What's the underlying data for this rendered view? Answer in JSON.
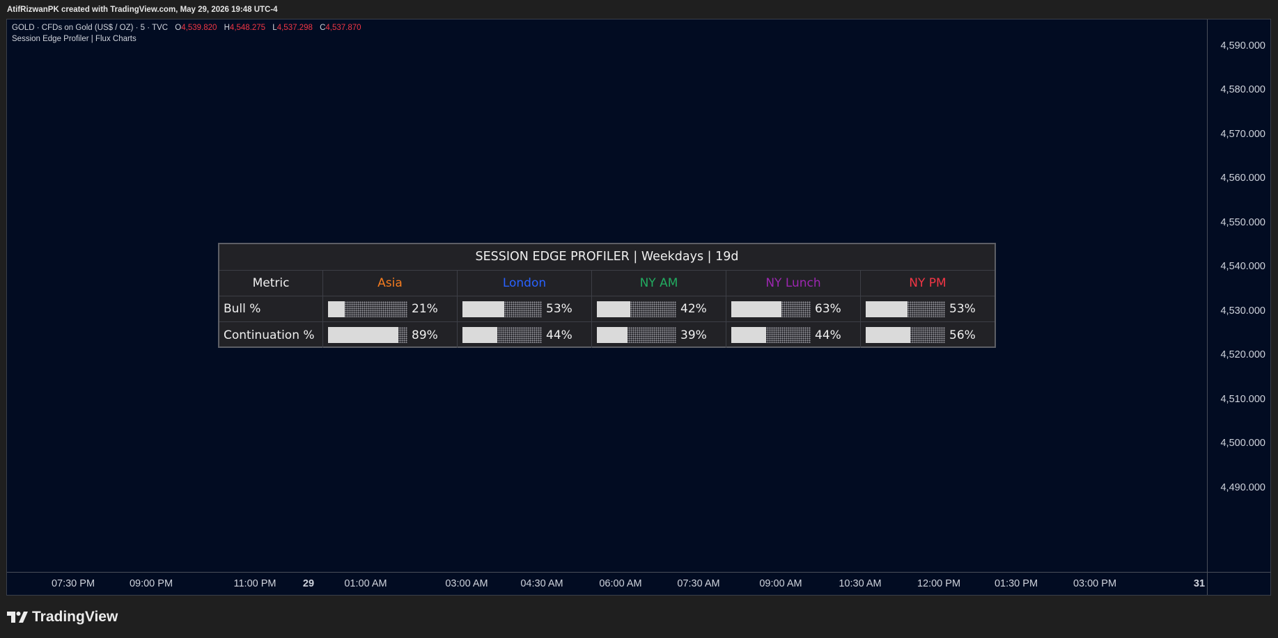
{
  "header": {
    "text": "AtifRizwanPK created with TradingView.com, May 29, 2026 19:48 UTC-4"
  },
  "legend": {
    "symbol": "GOLD · CFDs on Gold (US$ / OZ) · 5 · TVC",
    "open_label": "O",
    "open": "4,539.820",
    "high_label": "H",
    "high": "4,548.275",
    "low_label": "L",
    "low": "4,537.298",
    "close_label": "C",
    "close": "4,537.870",
    "indicator": "Session Edge Profiler | Flux Charts",
    "ohlc_color": "#f23645"
  },
  "price_axis": [
    "4,590.000",
    "4,580.000",
    "4,570.000",
    "4,560.000",
    "4,550.000",
    "4,540.000",
    "4,530.000",
    "4,520.000",
    "4,510.000",
    "4,500.000",
    "4,490.000"
  ],
  "time_axis": [
    {
      "label": "07:30 PM",
      "bold": false
    },
    {
      "label": "09:00 PM",
      "bold": false
    },
    {
      "label": "11:00 PM",
      "bold": false
    },
    {
      "label": "29",
      "bold": true
    },
    {
      "label": "01:00 AM",
      "bold": false
    },
    {
      "label": "03:00 AM",
      "bold": false
    },
    {
      "label": "04:30 AM",
      "bold": false
    },
    {
      "label": "06:00 AM",
      "bold": false
    },
    {
      "label": "07:30 AM",
      "bold": false
    },
    {
      "label": "09:00 AM",
      "bold": false
    },
    {
      "label": "10:30 AM",
      "bold": false
    },
    {
      "label": "12:00 PM",
      "bold": false
    },
    {
      "label": "01:30 PM",
      "bold": false
    },
    {
      "label": "03:00 PM",
      "bold": false
    },
    {
      "label": "31",
      "bold": true
    }
  ],
  "panel": {
    "title": "SESSION EDGE PROFILER | Weekdays | 19d",
    "metric_header": "Metric",
    "sessions": [
      {
        "name": "Asia",
        "color": "#f57c1f"
      },
      {
        "name": "London",
        "color": "#2962ff"
      },
      {
        "name": "NY AM",
        "color": "#22ab60"
      },
      {
        "name": "NY Lunch",
        "color": "#9c27b0"
      },
      {
        "name": "NY PM",
        "color": "#f23645"
      }
    ],
    "rows": [
      {
        "metric": "Bull %",
        "values": [
          {
            "text": "21%",
            "level": 0.21
          },
          {
            "text": "53%",
            "level": 0.53
          },
          {
            "text": "42%",
            "level": 0.42
          },
          {
            "text": "63%",
            "level": 0.63
          },
          {
            "text": "53%",
            "level": 0.53
          }
        ]
      },
      {
        "metric": "Continuation %",
        "values": [
          {
            "text": "89%",
            "level": 0.89
          },
          {
            "text": "44%",
            "level": 0.44
          },
          {
            "text": "39%",
            "level": 0.39
          },
          {
            "text": "44%",
            "level": 0.44
          },
          {
            "text": "56%",
            "level": 0.56
          }
        ]
      }
    ]
  },
  "footer": {
    "logo_text": "TradingView"
  }
}
